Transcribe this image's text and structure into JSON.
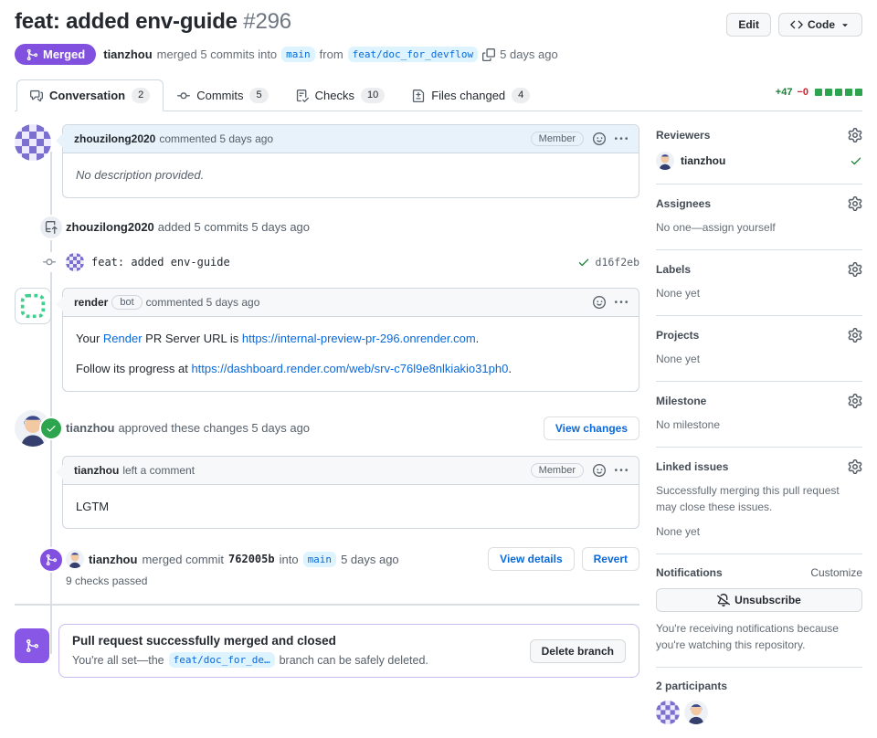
{
  "header": {
    "title": "feat: added env-guide",
    "number": "#296",
    "edit_label": "Edit",
    "code_label": "Code",
    "status_label": "Merged",
    "author": "tianzhou",
    "action": "merged 5 commits into",
    "base_branch": "main",
    "from_word": "from",
    "head_branch": "feat/doc_for_devflow",
    "time": "5 days ago"
  },
  "tabs": {
    "conversation": {
      "label": "Conversation",
      "count": "2"
    },
    "commits": {
      "label": "Commits",
      "count": "5"
    },
    "checks": {
      "label": "Checks",
      "count": "10"
    },
    "files": {
      "label": "Files changed",
      "count": "4"
    },
    "diff_additions": "+47",
    "diff_deletions": "−0"
  },
  "timeline": {
    "comment1": {
      "author": "zhouzilong2020",
      "action": "commented 5 days ago",
      "badge": "Member",
      "body": "No description provided."
    },
    "push_event": {
      "author": "zhouzilong2020",
      "action": "added 5 commits 5 days ago"
    },
    "commit": {
      "message": "feat: added env-guide",
      "sha": "d16f2eb"
    },
    "render_comment": {
      "author": "render",
      "badge": "bot",
      "action": "commented 5 days ago",
      "p1_a": "Your ",
      "p1_link1": "Render",
      "p1_b": " PR Server URL is ",
      "p1_link2": "https://internal-preview-pr-296.onrender.com",
      "p1_c": ".",
      "p2_a": "Follow its progress at ",
      "p2_link": "https://dashboard.render.com/web/srv-c76l9e8nlkiakio31ph0",
      "p2_b": "."
    },
    "approval": {
      "author": "tianzhou",
      "action": "approved these changes 5 days ago",
      "button": "View changes"
    },
    "review_comment": {
      "author": "tianzhou",
      "action": "left a comment",
      "badge": "Member",
      "body": "LGTM"
    },
    "merge": {
      "author": "tianzhou",
      "action": "merged commit",
      "sha": "762005b",
      "into_word": "into",
      "branch": "main",
      "time": "5 days ago",
      "checks": "9 checks passed",
      "view_details": "View details",
      "revert": "Revert"
    },
    "banner": {
      "title": "Pull request successfully merged and closed",
      "pre": "You're all set—the",
      "branch": "feat/doc_for_de…",
      "post": "branch can be safely deleted.",
      "button": "Delete branch"
    }
  },
  "sidebar": {
    "reviewers": {
      "title": "Reviewers",
      "user": "tianzhou"
    },
    "assignees": {
      "title": "Assignees",
      "empty": "No one—assign yourself"
    },
    "labels": {
      "title": "Labels",
      "empty": "None yet"
    },
    "projects": {
      "title": "Projects",
      "empty": "None yet"
    },
    "milestone": {
      "title": "Milestone",
      "empty": "No milestone"
    },
    "linked_issues": {
      "title": "Linked issues",
      "desc": "Successfully merging this pull request may close these issues.",
      "empty": "None yet"
    },
    "notifications": {
      "title": "Notifications",
      "customize": "Customize",
      "button": "Unsubscribe",
      "desc": "You're receiving notifications because you're watching this repository."
    },
    "participants": {
      "title": "2 participants"
    }
  }
}
